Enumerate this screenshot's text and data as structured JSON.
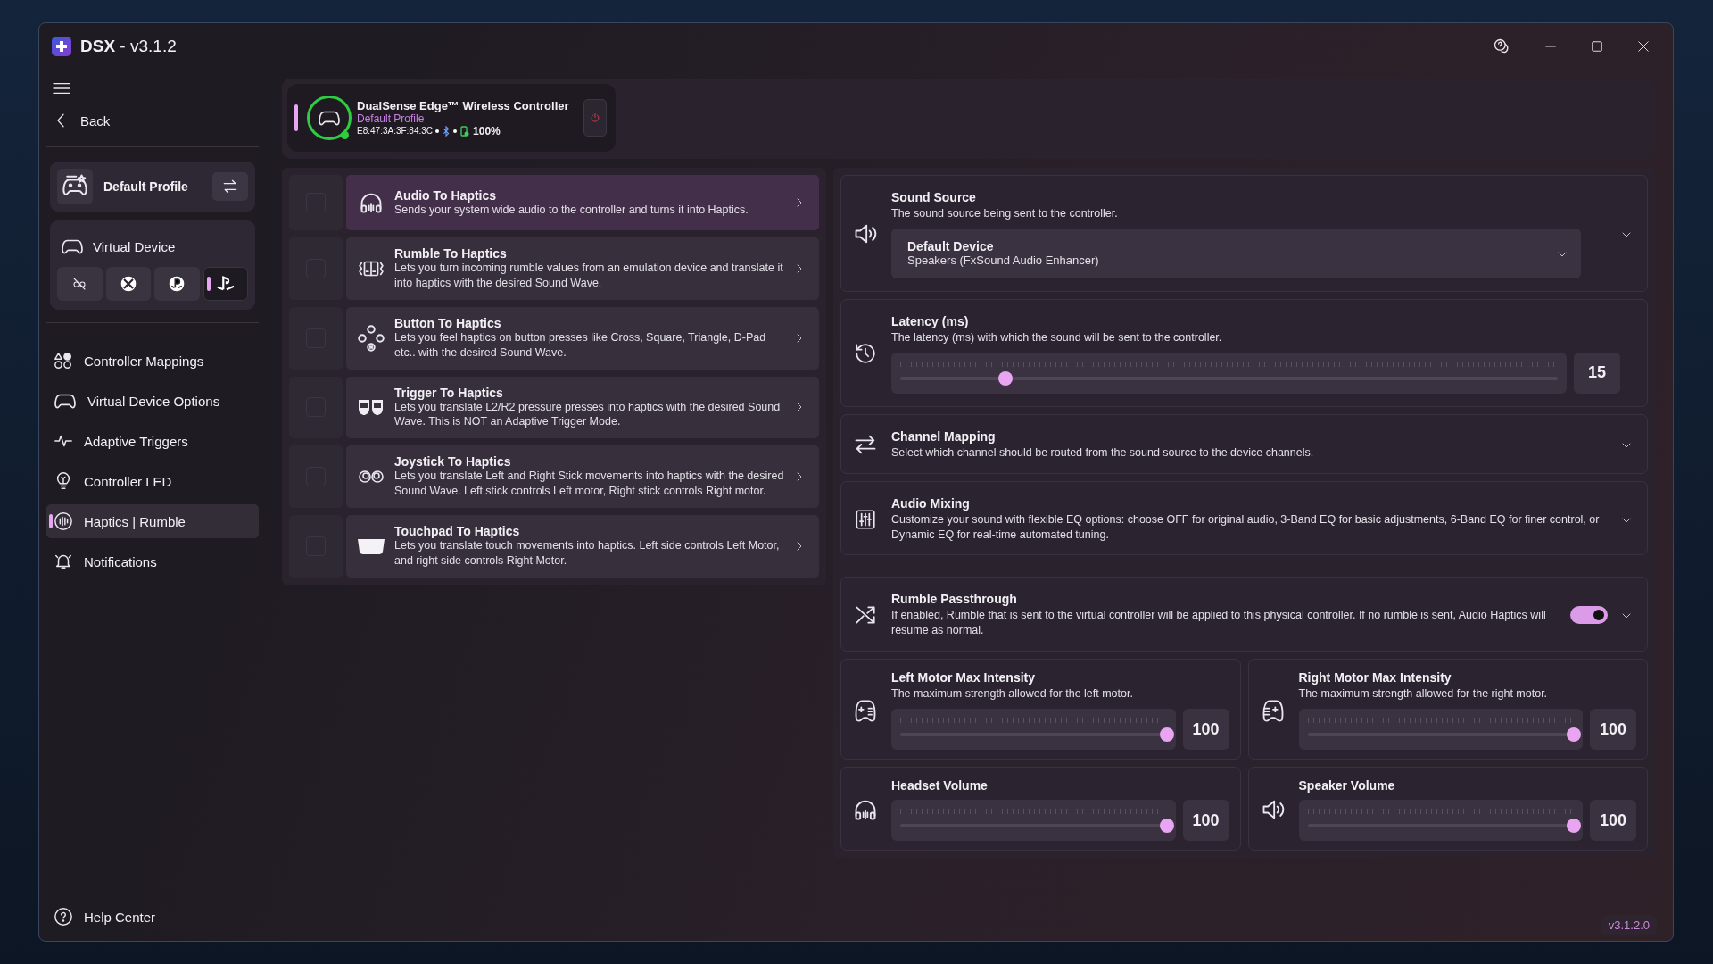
{
  "window": {
    "app_name": "DSX",
    "version": "- v3.1.2"
  },
  "sidebar": {
    "back": "Back",
    "profile": "Default Profile",
    "virtual_device": {
      "label": "Virtual Device",
      "options": [
        {
          "kind": "unlink",
          "selected": false
        },
        {
          "kind": "circle_x",
          "selected": false
        },
        {
          "kind": "circle_p",
          "selected": false
        },
        {
          "kind": "symbol",
          "selected": true
        }
      ]
    },
    "items": [
      {
        "label": "Controller Mappings",
        "kind": "shapes",
        "selected": false
      },
      {
        "label": "Virtual Device Options",
        "kind": "gamepad",
        "selected": false
      },
      {
        "label": "Adaptive Triggers",
        "kind": "pulse",
        "selected": false
      },
      {
        "label": "Controller LED",
        "kind": "bulb",
        "selected": false
      },
      {
        "label": "Haptics | Rumble",
        "kind": "haptics",
        "selected": true
      },
      {
        "label": "Notifications",
        "kind": "bell",
        "selected": false
      }
    ],
    "help": "Help Center"
  },
  "controller": {
    "name": "DualSense Edge™ Wireless Controller",
    "profile": "Default Profile",
    "mac": "E8:47:3A:3F:84:3C",
    "battery": "100%",
    "connected": true
  },
  "features": [
    {
      "kind": "headphones",
      "title": "Audio To Haptics",
      "description": "Sends your system wide audio to the controller and turns it into Haptics.",
      "selected": true,
      "checked": false
    },
    {
      "kind": "rumble",
      "title": "Rumble To Haptics",
      "description": "Lets you turn incoming rumble values from an emulation device and translate it into haptics with the desired Sound Wave.",
      "selected": false,
      "checked": false
    },
    {
      "kind": "buttons",
      "title": "Button To Haptics",
      "description": "Lets you feel haptics on button presses like Cross, Square, Triangle, D-Pad etc.. with the desired Sound Wave.",
      "selected": false,
      "checked": false
    },
    {
      "kind": "triggers",
      "title": "Trigger To Haptics",
      "description": "Lets you translate L2/R2 pressure presses into haptics with the desired Sound Wave. This is NOT an Adaptive Trigger Mode.",
      "selected": false,
      "checked": false
    },
    {
      "kind": "joysticks",
      "title": "Joystick To Haptics",
      "description": "Lets you translate Left and Right Stick movements into haptics with the desired Sound Wave. Left stick controls Left motor, Right stick controls Right motor.",
      "selected": false,
      "checked": false
    },
    {
      "kind": "touchpad",
      "title": "Touchpad To Haptics",
      "description": "Lets you translate touch movements into haptics. Left side controls Left Motor, and right side controls Right Motor.",
      "selected": false,
      "checked": false
    }
  ],
  "settings": [
    {
      "kind": "dropdown",
      "title": "Sound Source",
      "description": "The sound source being sent to the controller.",
      "value_title": "Default Device",
      "value_detail": "Speakers (FxSound Audio Enhancer)"
    },
    {
      "kind": "slider",
      "title": "Latency (ms)",
      "description": "The latency (ms) with which the sound will be sent to the controller.",
      "level": 0.16,
      "reading": "15"
    },
    {
      "kind": "expander",
      "title": "Channel Mapping",
      "description": "Select which channel should be routed from the sound source to the device channels."
    },
    {
      "kind": "expander",
      "title": "Audio Mixing",
      "description": "Customize your sound with flexible EQ options: choose OFF for original audio, 3-Band EQ for basic adjustments, 6-Band EQ for finer control, or Dynamic EQ for real-time automated tuning."
    },
    {
      "kind": "toggle",
      "title": "Rumble Passthrough",
      "description": "If enabled, Rumble that is sent to the virtual controller will be applied to this physical controller. If no rumble is sent, Audio Haptics will resume as normal.",
      "on": true
    }
  ],
  "motor_settings": [
    {
      "title": "Left Motor Max Intensity",
      "description": "The maximum strength allowed for the left motor.",
      "level": 1.0,
      "reading": "100"
    },
    {
      "title": "Right Motor Max Intensity",
      "description": "The maximum strength allowed for the right motor.",
      "level": 1.0,
      "reading": "100"
    },
    {
      "title": "Headset Volume",
      "level": 1.0,
      "reading": "100"
    },
    {
      "title": "Speaker Volume",
      "level": 1.0,
      "reading": "100"
    }
  ],
  "version_badge": "v3.1.2.0"
}
